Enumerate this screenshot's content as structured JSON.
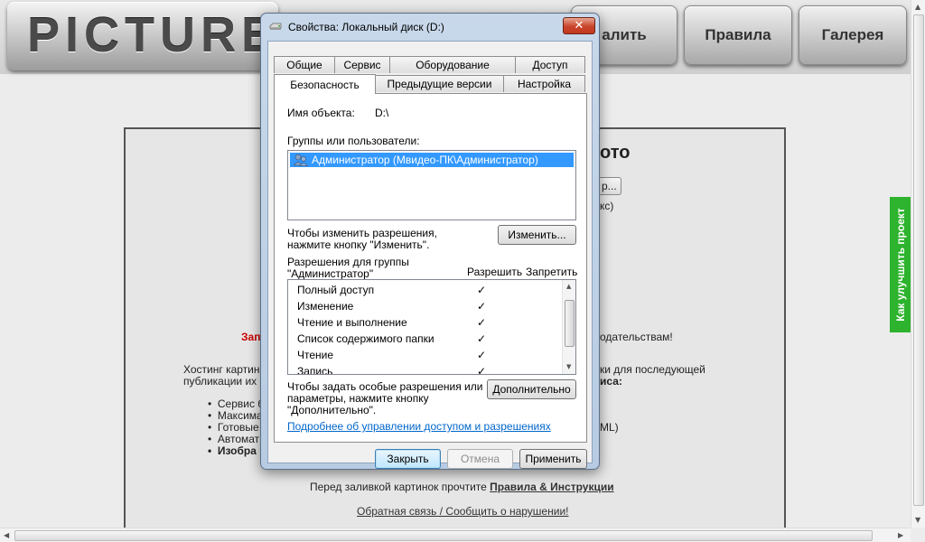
{
  "site": {
    "logo": "PICTURE",
    "nav": {
      "partial": "алить",
      "rules": "Правила",
      "gallery": "Галерея"
    },
    "headline_partial": "ото",
    "browse_partial": "р...",
    "size_partial": "кс)",
    "warning_start": "Зап",
    "warning_end": "одательствам!",
    "hosting_line1_start": "Хостинг картин",
    "hosting_line1_end": "ки для последующей",
    "hosting_line2_start": "публикации их н",
    "hosting_line2_end": "иса:",
    "bullets": [
      "Сервис б",
      "Максима",
      "Готовые",
      "Автомат",
      "Изобра"
    ],
    "html_partial": "ML)",
    "before_upload": "Перед заливкой картинок прочтите",
    "rules_link": "Правила & Инструкции",
    "feedback_link": "Обратная связь / Сообщить о нарушении!",
    "improve_tab": "Как улучшить проект"
  },
  "dialog": {
    "title": "Свойства: Локальный диск (D:)",
    "close_label": "✕",
    "tabs_row1": [
      "Общие",
      "Сервис",
      "Оборудование",
      "Доступ"
    ],
    "tabs_row2": [
      "Безопасность",
      "Предыдущие версии",
      "Настройка"
    ],
    "object_label": "Имя объекта:",
    "object_value": "D:\\",
    "groups_label": "Группы или пользователи:",
    "users": [
      "Администратор (Мвидео-ПК\\Администратор)"
    ],
    "change_hint_1": "Чтобы изменить разрешения,",
    "change_hint_2": "нажмите кнопку \"Изменить\".",
    "change_button": "Изменить...",
    "perms_label_1": "Разрешения для группы",
    "perms_label_2": "\"Администратор\"",
    "allow_header": "Разрешить",
    "deny_header": "Запретить",
    "permissions": [
      {
        "name": "Полный доступ",
        "allow": "✓"
      },
      {
        "name": "Изменение",
        "allow": "✓"
      },
      {
        "name": "Чтение и выполнение",
        "allow": "✓"
      },
      {
        "name": "Список содержимого папки",
        "allow": "✓"
      },
      {
        "name": "Чтение",
        "allow": "✓"
      },
      {
        "name": "Запись",
        "allow": "✓"
      }
    ],
    "special_hint_1": "Чтобы задать особые разрешения или",
    "special_hint_2": "параметры, нажмите кнопку",
    "special_hint_3": "\"Дополнительно\".",
    "advanced_button": "Дополнительно",
    "help_link": "Подробнее об управлении доступом и разрешениях",
    "ok_button": "Закрыть",
    "cancel_button": "Отмена",
    "apply_button": "Применить"
  }
}
